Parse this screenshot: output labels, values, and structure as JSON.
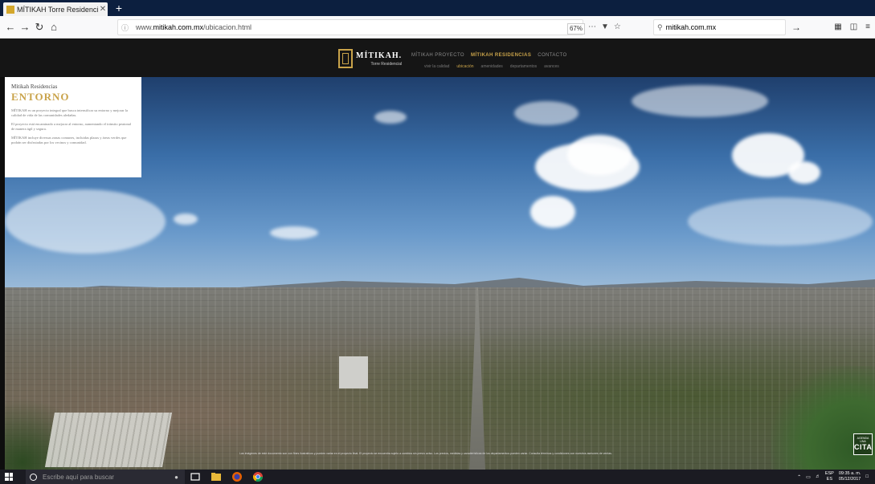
{
  "browser": {
    "tab_title": "MÍTIKAH Torre Residencial | Ub",
    "tab_close": "✕",
    "new_tab": "+",
    "url_prefix": "www.",
    "url_domain": "mitikah.com.mx",
    "url_path": "/ubicacion.html",
    "zoom": "67%",
    "search_value": "mitikah.com.mx"
  },
  "site": {
    "brand": "MÍTIKAH.",
    "brand_sub": "Torre Residencial",
    "menu": [
      "MÍTIKAH PROYECTO",
      "MÍTIKAH RESIDENCIAS",
      "CONTACTO"
    ],
    "submenu": [
      "vivir la calidad",
      "ubicación",
      "amenidades",
      "departamentos",
      "avances"
    ]
  },
  "panel": {
    "crumb": "Mítikah Residencias",
    "title": "ENTORNO",
    "p1": "MÍTIKAH es un proyecto integral que busca intensificar su entorno y mejorar la calidad de vida de las comunidades aledañas.",
    "p2": "El proyecto está encaminado a mejorar al entorno, aumentando el tránsito peatonal de manera ágil y segura.",
    "p3": "MÍTIKAH incluye diversas zonas comunes, incluidas plazas y áreas verdes que podrán ser disfrutadas por los vecinos y comunidad."
  },
  "legal": "Las imágenes de este documento son con fines ilustrativos y pueden variar en el proyecto final. El proyecto se encuentra sujeto a cambios sin previo aviso. Los precios, medidas y características de los departamentos pueden variar. Consulta términos y condiciones con nuestros asesores de ventas.",
  "cita": {
    "small": "AGENDA UNA",
    "big": "CITA"
  },
  "taskbar": {
    "search_placeholder": "Escribe aquí para buscar",
    "lang_top": "ESP",
    "lang_bottom": "ES",
    "time": "09:35 a. m.",
    "date": "05/12/2017"
  },
  "colors": {
    "accent": "#c9a34a",
    "header_bg": "#151515",
    "tab_strip": "#0c1f3f"
  }
}
